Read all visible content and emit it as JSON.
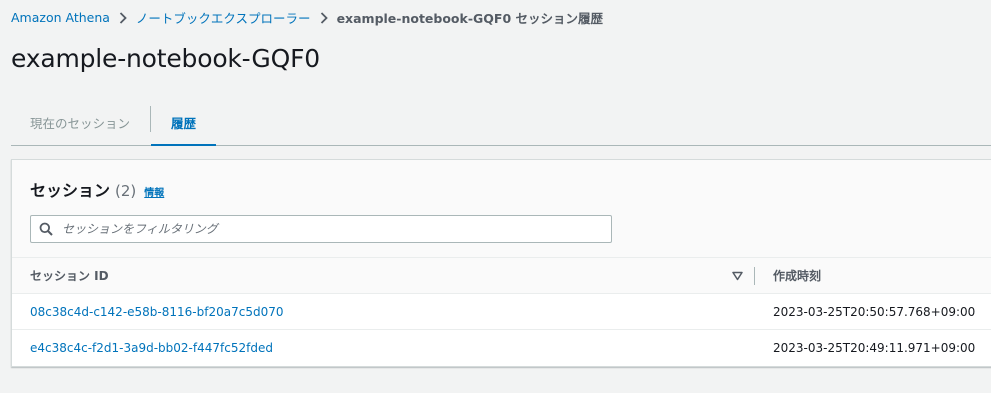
{
  "breadcrumb": {
    "root": "Amazon Athena",
    "explorer": "ノートブックエクスプローラー",
    "current": "example-notebook-GQF0 セッション履歴"
  },
  "page_title": "example-notebook-GQF0",
  "tabs": [
    {
      "label": "現在のセッション",
      "active": false
    },
    {
      "label": "履歴",
      "active": true
    }
  ],
  "sessions_panel": {
    "title": "セッション",
    "count": "(2)",
    "info_link": "情報",
    "filter_placeholder": "セッションをフィルタリング",
    "columns": [
      "セッション ID",
      "作成時刻"
    ],
    "rows": [
      {
        "id": "08c38c4d-c142-e58b-8116-bf20a7c5d070",
        "created": "2023-03-25T20:50:57.768+09:00"
      },
      {
        "id": "e4c38c4c-f2d1-3a9d-bb02-f447fc52fded",
        "created": "2023-03-25T20:49:11.971+09:00"
      }
    ]
  },
  "icons": {
    "search": "search-icon",
    "sort": "sort-down-icon",
    "breadcrumb_separator": "chevron-right-icon"
  },
  "colors": {
    "link": "#0073bb",
    "background": "#f2f3f3",
    "text": "#16191f"
  }
}
